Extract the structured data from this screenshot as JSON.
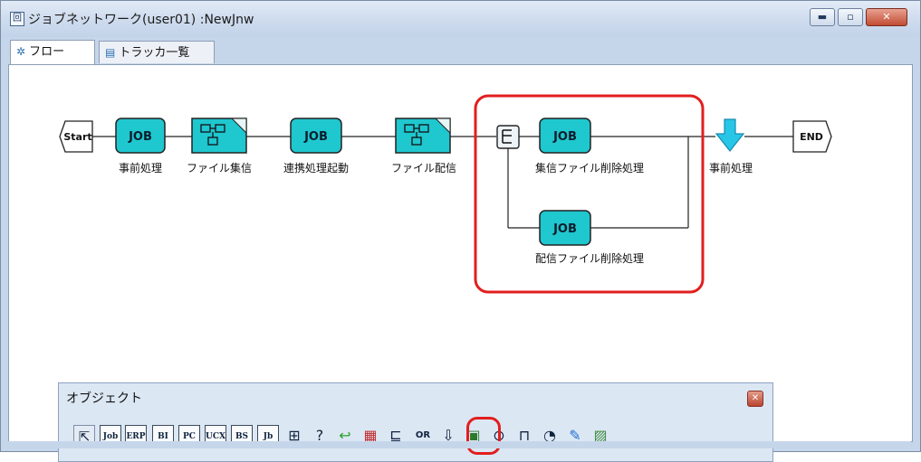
{
  "window": {
    "title": "ジョブネットワーク(user01) :NewJnw",
    "icons": {
      "app": "jobnetwork-icon",
      "minimize": "minimize-icon",
      "maximize": "maximize-icon",
      "close": "close-icon"
    }
  },
  "tabs": [
    {
      "label": "フロー",
      "icon": "flow-icon",
      "active": true
    },
    {
      "label": "トラッカ一覧",
      "icon": "tracker-list-icon",
      "active": false
    }
  ],
  "flow": {
    "start_label": "Start",
    "end_label": "END",
    "job_text": "JOB",
    "nodes": [
      {
        "id": "pre",
        "kind": "job",
        "caption": "事前処理"
      },
      {
        "id": "recv",
        "kind": "file",
        "caption": "ファイル集信"
      },
      {
        "id": "link",
        "kind": "job",
        "caption": "連携処理起動"
      },
      {
        "id": "send",
        "kind": "file",
        "caption": "ファイル配信"
      },
      {
        "id": "del1",
        "kind": "job",
        "caption": "集信ファイル削除処理"
      },
      {
        "id": "del2",
        "kind": "job",
        "caption": "配信ファイル削除処理"
      },
      {
        "id": "post",
        "kind": "arrow",
        "caption": "事前処理"
      }
    ],
    "branch_icon": "parallel-branch-icon",
    "highlight_color": "#e21e1e",
    "job_color": "#1fc7cf"
  },
  "palette": {
    "title": "オブジェクト",
    "tools": [
      {
        "name": "pointer",
        "label": "⇱",
        "type": "sel"
      },
      {
        "name": "job",
        "label": "Job"
      },
      {
        "name": "erp",
        "label": "ERP"
      },
      {
        "name": "bi",
        "label": "BI"
      },
      {
        "name": "pc",
        "label": "PC"
      },
      {
        "name": "ucx",
        "label": "UCX"
      },
      {
        "name": "bs",
        "label": "BS"
      },
      {
        "name": "jobnet",
        "label": "Jb"
      },
      {
        "name": "file-flow",
        "label": "⊞"
      },
      {
        "name": "condition",
        "label": "?"
      },
      {
        "name": "wait-arrow",
        "label": "↩"
      },
      {
        "name": "calendar",
        "label": "▦"
      },
      {
        "name": "parallel-branch",
        "label": "⊑"
      },
      {
        "name": "or-branch",
        "label": "OR"
      },
      {
        "name": "arrow-down",
        "label": "⇩"
      },
      {
        "name": "file-wait",
        "label": "▣"
      },
      {
        "name": "event-send",
        "label": "⊙"
      },
      {
        "name": "event-receive",
        "label": "⊓"
      },
      {
        "name": "time-wait",
        "label": "◔"
      },
      {
        "name": "dialog",
        "label": "✎"
      },
      {
        "name": "picture",
        "label": "▨"
      }
    ]
  }
}
